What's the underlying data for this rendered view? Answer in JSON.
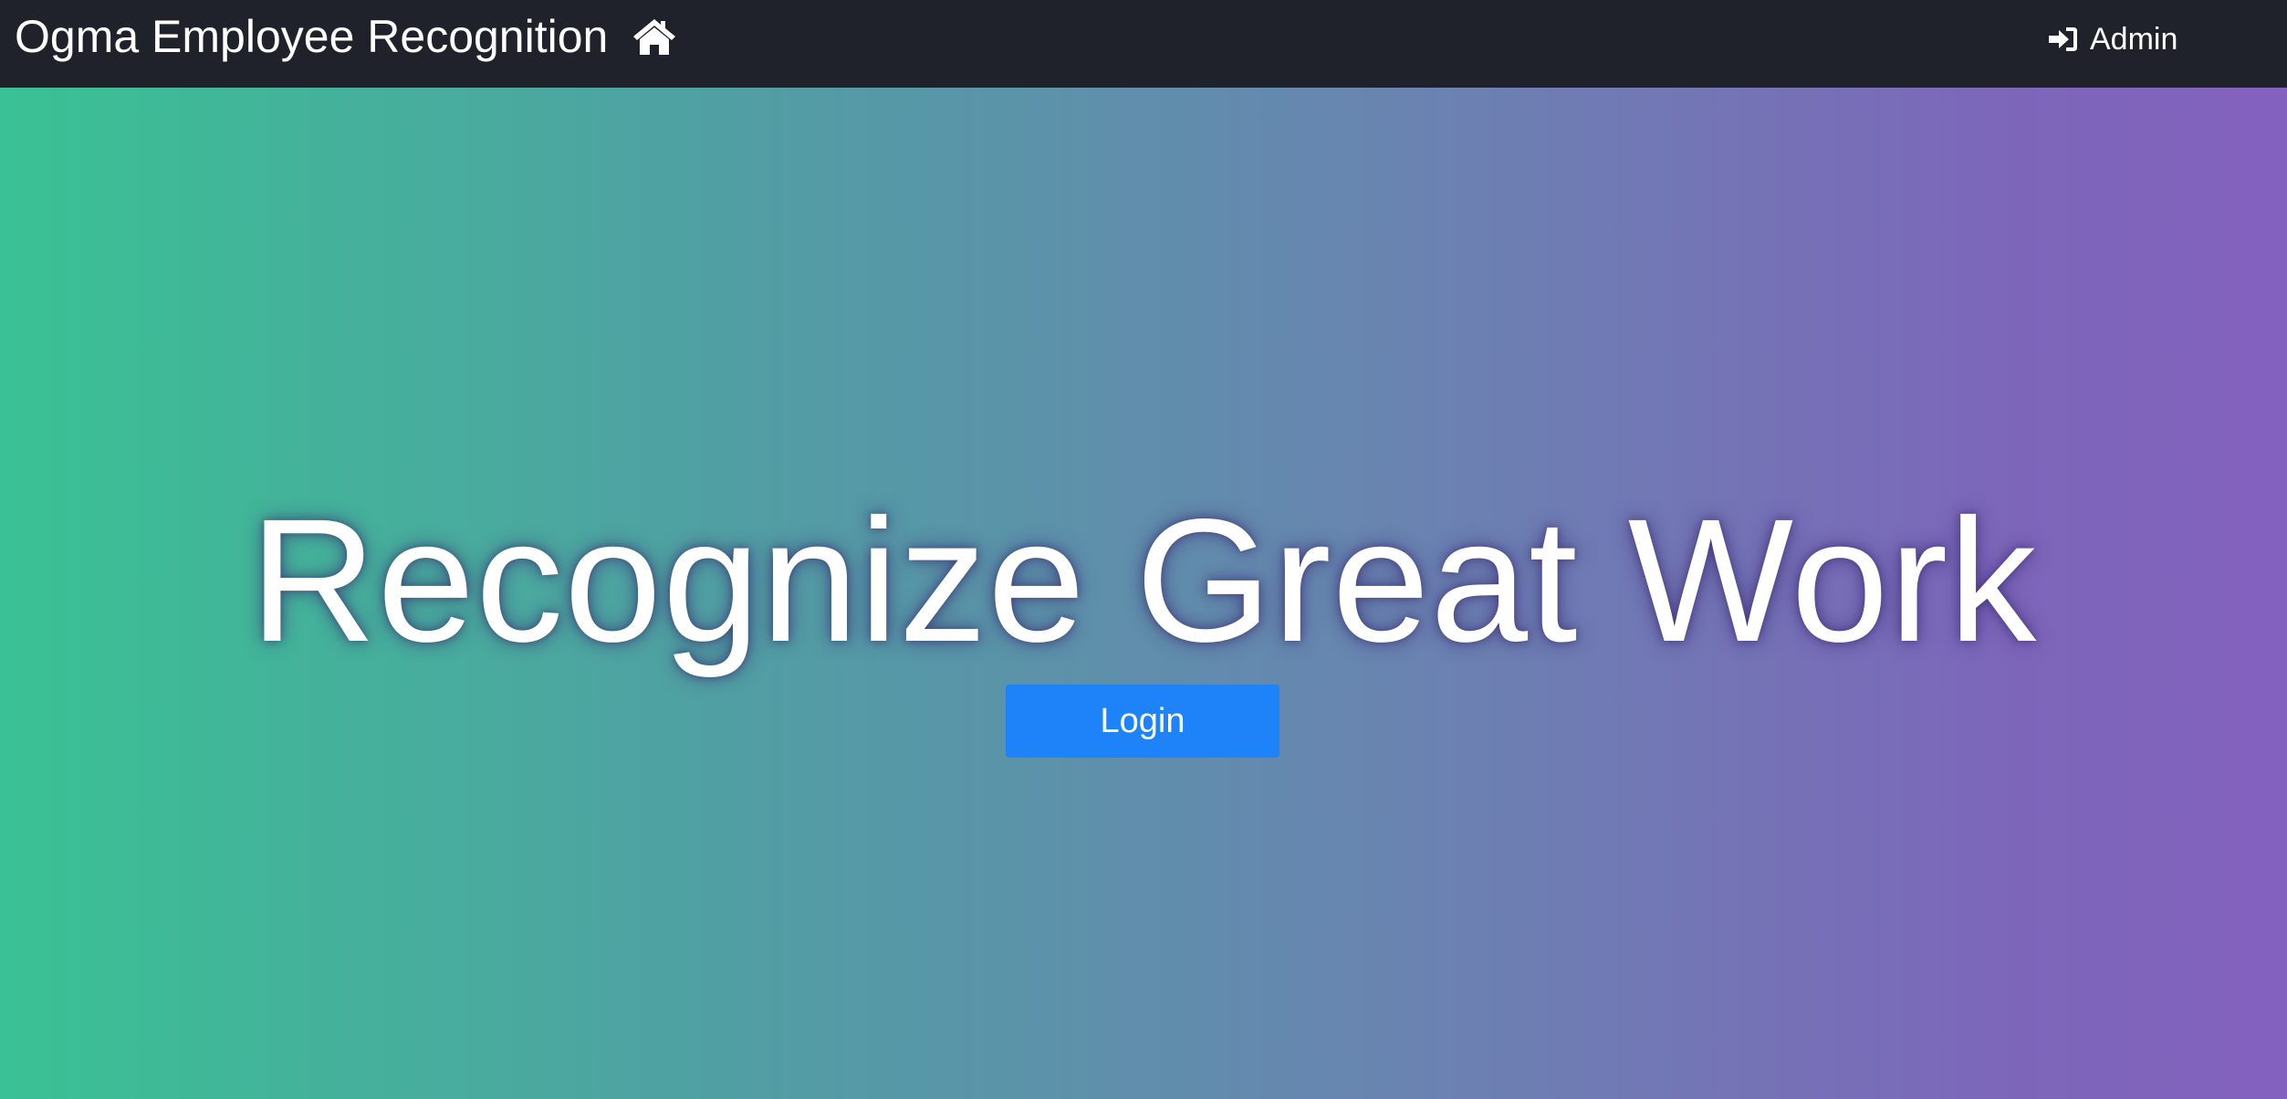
{
  "navbar": {
    "brand_label": "Ogma Employee Recognition",
    "home_icon": "home-icon",
    "admin_label": "Admin",
    "admin_icon": "sign-in-icon",
    "background_color": "#20222b"
  },
  "hero": {
    "title": "Recognize Great Work",
    "login_label": "Login",
    "gradient_colors": [
      "#3ac194",
      "#539ca5",
      "#6a83b1",
      "#7c67ba",
      "#8361be"
    ],
    "button_color": "#1e82f8"
  }
}
